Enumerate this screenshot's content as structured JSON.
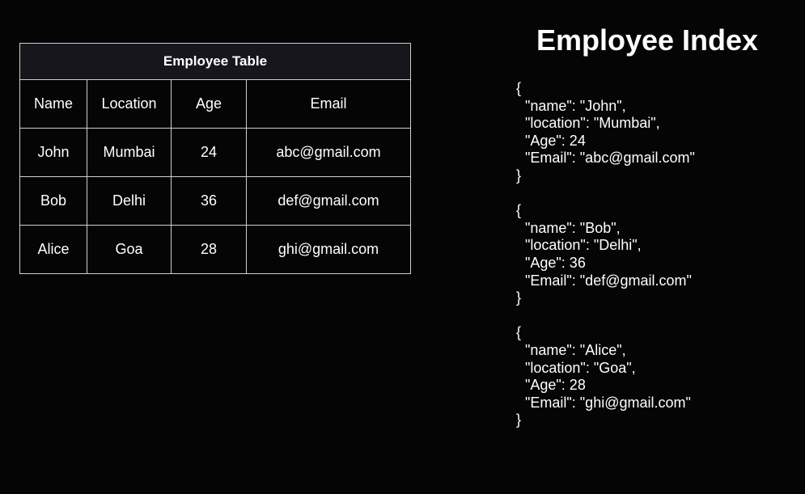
{
  "table": {
    "caption": "Employee Table",
    "headers": [
      "Name",
      "Location",
      "Age",
      "Email"
    ],
    "rows": [
      [
        "John",
        "Mumbai",
        "24",
        "abc@gmail.com"
      ],
      [
        "Bob",
        "Delhi",
        "36",
        "def@gmail.com"
      ],
      [
        "Alice",
        "Goa",
        "28",
        "ghi@gmail.com"
      ]
    ]
  },
  "index": {
    "title": "Employee Index",
    "records": [
      {
        "open": "{",
        "lines": [
          "\"name\": \"John\",",
          "\"location\": \"Mumbai\",",
          "\"Age\": 24",
          "\"Email\": \"abc@gmail.com\""
        ],
        "close": "}"
      },
      {
        "open": "{",
        "lines": [
          "\"name\": \"Bob\",",
          "\"location\": \"Delhi\",",
          "\"Age\": 36",
          "\"Email\": \"def@gmail.com\""
        ],
        "close": "}"
      },
      {
        "open": "{",
        "lines": [
          "\"name\": \"Alice\",",
          "\"location\": \"Goa\",",
          "\"Age\": 28",
          "\"Email\": \"ghi@gmail.com\""
        ],
        "close": "}"
      }
    ]
  }
}
